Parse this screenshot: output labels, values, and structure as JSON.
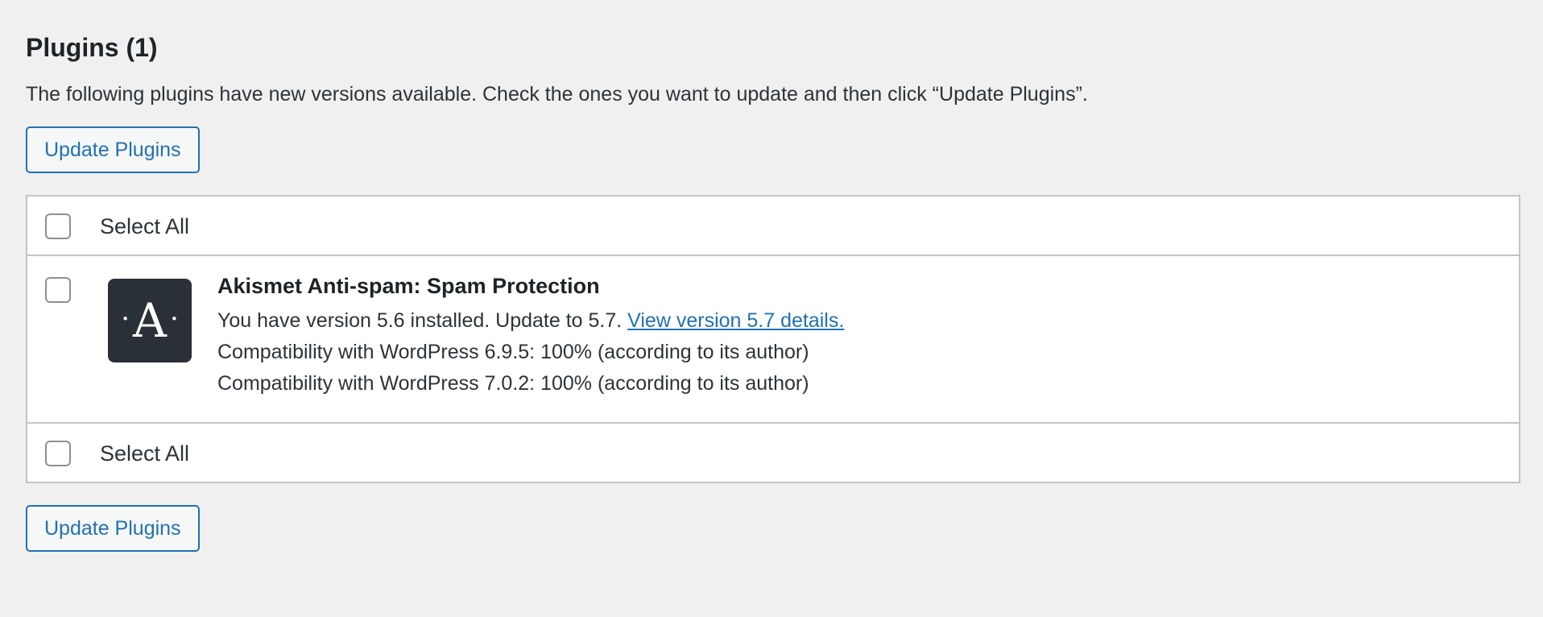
{
  "page": {
    "title": "Plugins (1)",
    "intro": "The following plugins have new versions available. Check the ones you want to update and then click “Update Plugins”."
  },
  "actions": {
    "update_button_label": "Update Plugins"
  },
  "table": {
    "select_all_label": "Select All",
    "plugins": [
      {
        "name": "Akismet Anti-spam: Spam Protection",
        "icon": "akismet-logo-icon",
        "icon_letter": "A",
        "icon_dot": "·",
        "version_text": "You have version 5.6 installed. Update to 5.7.",
        "details_link": "View version 5.7 details.",
        "compat_1": "Compatibility with WordPress 6.9.5: 100% (according to its author)",
        "compat_2": "Compatibility with WordPress 7.0.2: 100% (according to its author)"
      }
    ]
  },
  "colors": {
    "accent": "#2271b1",
    "background": "#f0f0f1",
    "icon_bg": "#2a3038"
  }
}
